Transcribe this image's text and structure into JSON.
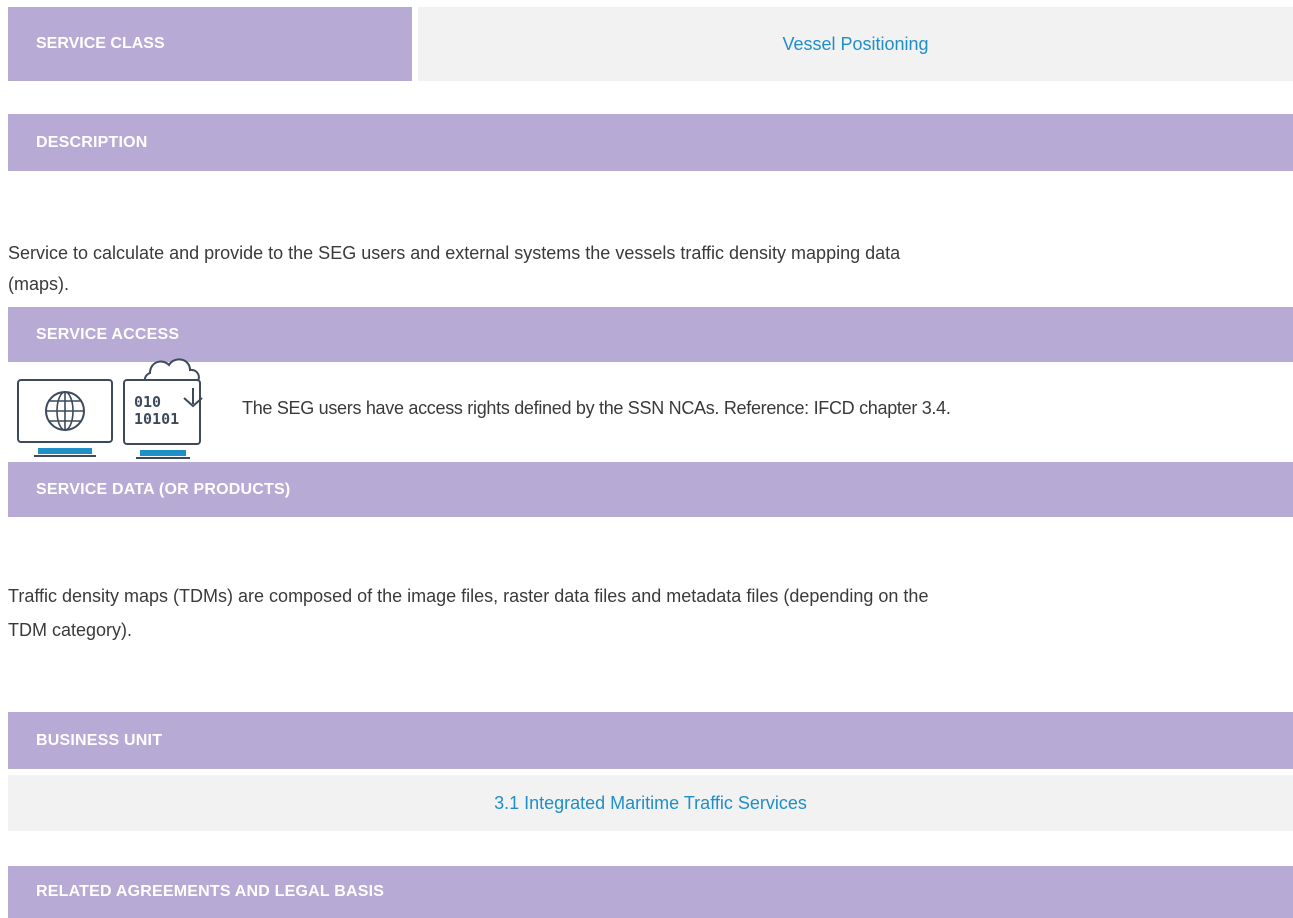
{
  "service_class": {
    "label": "SERVICE CLASS",
    "value": "Vessel Positioning"
  },
  "description": {
    "heading": "DESCRIPTION",
    "line1": "Service to calculate and provide to the SEG users and external systems the vessels traffic density mapping data",
    "line2": "(maps)."
  },
  "service_access": {
    "heading": "SERVICE ACCESS",
    "text": "The SEG users have access rights defined by the SSN NCAs. Reference: IFCD chapter 3.4.",
    "icons": [
      "globe-monitor-icon",
      "cloud-binary-monitor-icon"
    ],
    "binary_line1": "010",
    "binary_line2": "10101"
  },
  "service_data": {
    "heading": "SERVICE DATA (OR PRODUCTS)",
    "line1": "Traffic density maps (TDMs) are composed of the image files, raster data files and metadata files (depending on the",
    "line2": "TDM category)."
  },
  "business_unit": {
    "heading": "BUSINESS UNIT",
    "value": "3.1 Integrated Maritime Traffic Services"
  },
  "related": {
    "heading": "RELATED AGREEMENTS AND LEGAL BASIS"
  },
  "colors": {
    "band": "#b7aad5",
    "value_bg": "#f2f2f2",
    "link": "#1f8fc7",
    "icon_stroke": "#3d4a5c",
    "icon_accent": "#1f8fc7"
  }
}
